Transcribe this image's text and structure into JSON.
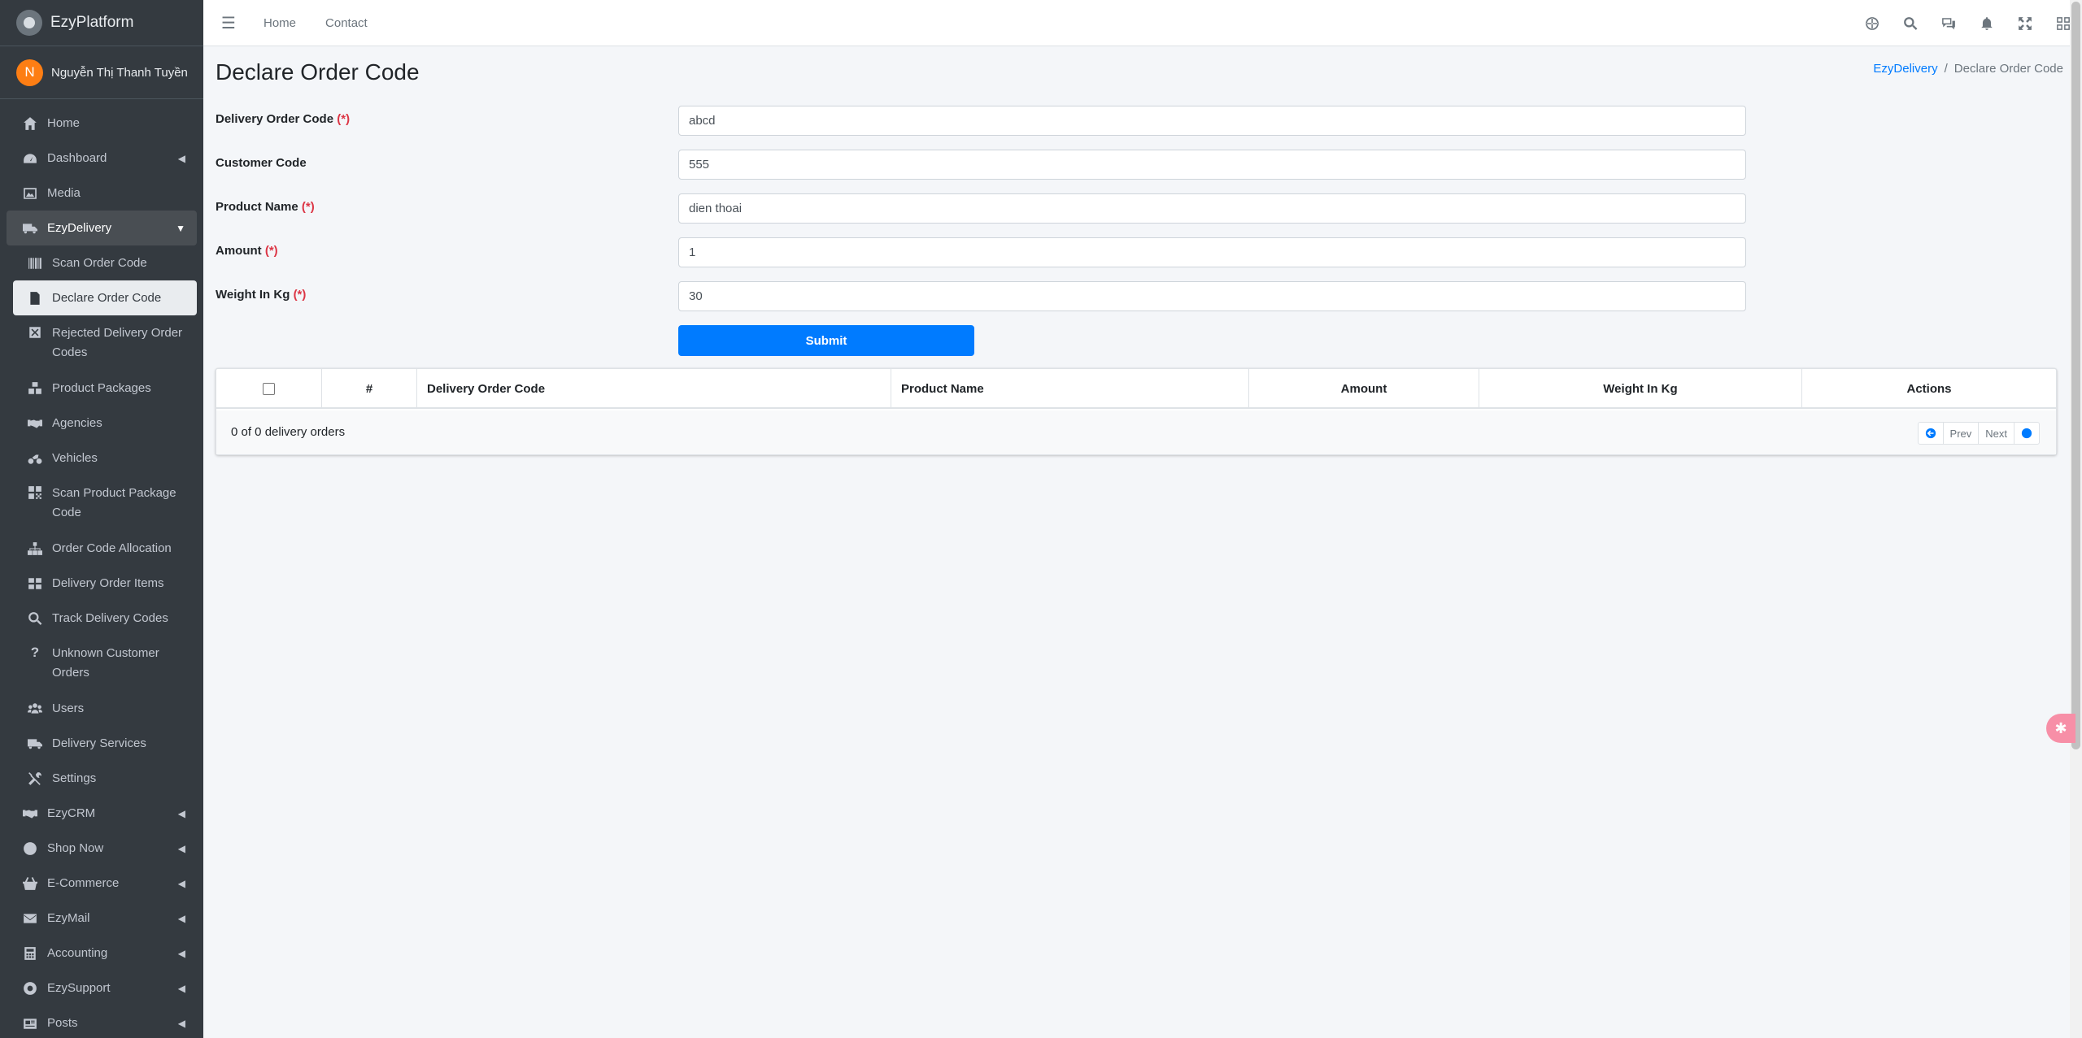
{
  "brand": {
    "name": "EzyPlatform"
  },
  "user": {
    "initial": "N",
    "name": "Nguyễn Thị Thanh Tuyền"
  },
  "sidebar": {
    "items_top": [
      {
        "label": "Home",
        "icon": "home-icon"
      },
      {
        "label": "Dashboard",
        "icon": "dashboard-icon"
      },
      {
        "label": "Media",
        "icon": "image-icon"
      },
      {
        "label": "EzyDelivery",
        "icon": "truck-icon"
      }
    ],
    "delivery_sub": [
      {
        "label": "Scan Order Code",
        "icon": "barcode-icon"
      },
      {
        "label": "Declare Order Code",
        "icon": "file-icon"
      },
      {
        "label": "Rejected Delivery Order Codes",
        "icon": "reject-icon"
      },
      {
        "label": "Product Packages",
        "icon": "packages-icon"
      },
      {
        "label": "Agencies",
        "icon": "handshake-icon"
      },
      {
        "label": "Vehicles",
        "icon": "motorcycle-icon"
      },
      {
        "label": "Scan Product Package Code",
        "icon": "qrcode-icon"
      },
      {
        "label": "Order Code Allocation",
        "icon": "sitemap-icon"
      },
      {
        "label": "Delivery Order Items",
        "icon": "grid-icon"
      },
      {
        "label": "Track Delivery Codes",
        "icon": "search-icon"
      },
      {
        "label": "Unknown Customer Orders",
        "icon": "question-icon"
      },
      {
        "label": "Users",
        "icon": "users-icon"
      },
      {
        "label": "Delivery Services",
        "icon": "truck-icon"
      },
      {
        "label": "Settings",
        "icon": "tools-icon"
      }
    ],
    "items_bottom": [
      {
        "label": "EzyCRM",
        "icon": "handshake-icon"
      },
      {
        "label": "Shop Now",
        "icon": "circle-icon"
      },
      {
        "label": "E-Commerce",
        "icon": "basket-icon"
      },
      {
        "label": "EzyMail",
        "icon": "envelope-icon"
      },
      {
        "label": "Accounting",
        "icon": "calculator-icon"
      },
      {
        "label": "EzySupport",
        "icon": "lifering-icon"
      },
      {
        "label": "Posts",
        "icon": "newspaper-icon"
      }
    ]
  },
  "header": {
    "home": "Home",
    "contact": "Contact"
  },
  "page": {
    "title": "Declare Order Code",
    "breadcrumb": {
      "parent": "EzyDelivery",
      "sep": "/",
      "current": "Declare Order Code"
    }
  },
  "form": {
    "delivery_order_code": {
      "label": "Delivery Order Code",
      "required": "(*)",
      "value": "abcd"
    },
    "customer_code": {
      "label": "Customer Code",
      "value": "555"
    },
    "product_name": {
      "label": "Product Name",
      "required": "(*)",
      "value": "dien thoai"
    },
    "amount": {
      "label": "Amount",
      "required": "(*)",
      "value": "1"
    },
    "weight": {
      "label": "Weight In Kg",
      "required": "(*)",
      "value": "30"
    },
    "submit": "Submit"
  },
  "table": {
    "columns": [
      "#",
      "Delivery Order Code",
      "Product Name",
      "Amount",
      "Weight In Kg",
      "Actions"
    ],
    "count_text": "0 of 0 delivery orders",
    "prev": "Prev",
    "next": "Next"
  },
  "colors": {
    "primary": "#007bff",
    "sidebar": "#343a40",
    "required": "#dc3545"
  }
}
